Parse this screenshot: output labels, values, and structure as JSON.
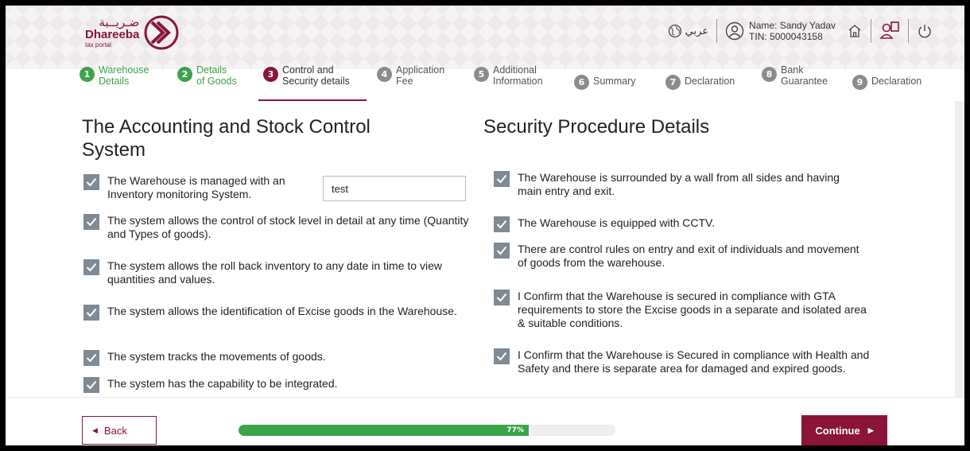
{
  "header": {
    "logo_ar": "ضـريــبة",
    "logo_en": "Dhareeba",
    "logo_sub": "tax portal",
    "lang_label": "عربي",
    "user_name": "Name: Sandy Yadav",
    "user_tin": "TIN: 5000043158",
    "icons": [
      "globe-icon",
      "user-icon",
      "home-icon",
      "profile-switch-icon",
      "power-icon"
    ]
  },
  "steps": [
    {
      "num": "1",
      "line1": "Warehouse",
      "line2": "Details",
      "state": "done"
    },
    {
      "num": "2",
      "line1": "Details",
      "line2": "of Goods",
      "state": "done"
    },
    {
      "num": "3",
      "line1": "Control and",
      "line2": "Security details",
      "state": "active"
    },
    {
      "num": "4",
      "line1": "Application",
      "line2": "Fee",
      "state": "pending"
    },
    {
      "num": "5",
      "line1": "Additional",
      "line2": "Information",
      "state": "pending"
    },
    {
      "num": "6",
      "line1": "Summary",
      "line2": "",
      "state": "pending"
    },
    {
      "num": "7",
      "line1": "Declaration",
      "line2": "",
      "state": "pending"
    },
    {
      "num": "8",
      "line1": "Bank",
      "line2": "Guarantee",
      "state": "pending"
    },
    {
      "num": "9",
      "line1": "Declaration",
      "line2": "",
      "state": "pending"
    }
  ],
  "accounting": {
    "title_line1": "The Accounting and Stock Control",
    "title_line2": "System",
    "items": [
      {
        "text": "The Warehouse is managed with an Inventory monitoring System.",
        "checked": true
      },
      {
        "text": "The system allows the control of stock level in detail at any time (Quantity and Types of goods).",
        "checked": true
      },
      {
        "text": "The system allows the roll back inventory to any date in time to view quantities and values.",
        "checked": true
      },
      {
        "text": "The system allows the identification of Excise goods in the Warehouse.",
        "checked": true
      },
      {
        "text": "The system tracks the movements of goods.",
        "checked": true
      },
      {
        "text": "The system has the capability to be integrated.",
        "checked": true
      }
    ],
    "inventory_system_value": "test"
  },
  "security": {
    "title": "Security Procedure Details",
    "items": [
      {
        "text": "The Warehouse is surrounded by a wall from all sides and having main entry and exit.",
        "checked": true
      },
      {
        "text": "The Warehouse is equipped with CCTV.",
        "checked": true
      },
      {
        "text": "There are control rules on entry and exit of individuals and movement of goods from the warehouse.",
        "checked": true
      },
      {
        "text": "I Confirm that the Warehouse is secured in compliance with GTA requirements to store the Excise goods in a separate and isolated area & suitable conditions.",
        "checked": true
      },
      {
        "text": "I Confirm that the Warehouse is Secured in compliance with Health and Safety and there is separate area for damaged and expired goods.",
        "checked": true
      }
    ]
  },
  "footer": {
    "back_label": "Back",
    "continue_label": "Continue",
    "progress_percent": 77,
    "progress_text": "77%"
  },
  "colors": {
    "brand": "#8a1538",
    "done": "#3fa34d",
    "progress": "#3aa44a",
    "checkbox": "#7e8a94"
  }
}
